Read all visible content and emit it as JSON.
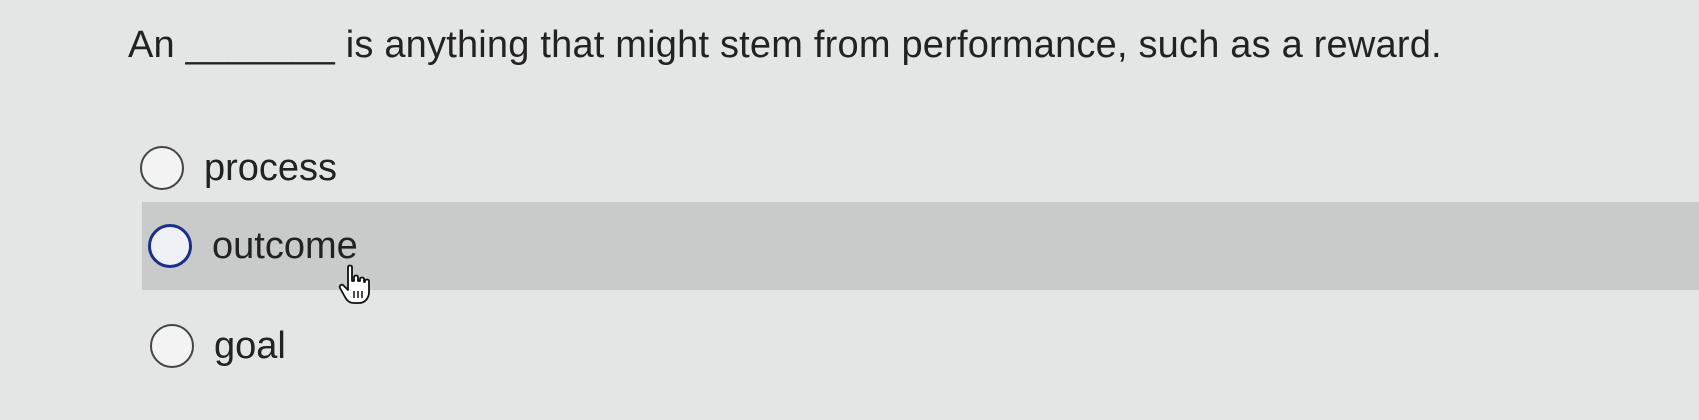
{
  "question": {
    "text": "An _______ is anything that might stem from performance, such as a reward."
  },
  "options": [
    {
      "label": "process",
      "state": "default"
    },
    {
      "label": "outcome",
      "state": "hovered"
    },
    {
      "label": "goal",
      "state": "default"
    }
  ],
  "colors": {
    "background": "#e4e6e5",
    "hover_background": "#c9cbca",
    "focus_ring": "#1b2f8a"
  },
  "icons": {
    "pointer": "hand-pointer-icon"
  }
}
